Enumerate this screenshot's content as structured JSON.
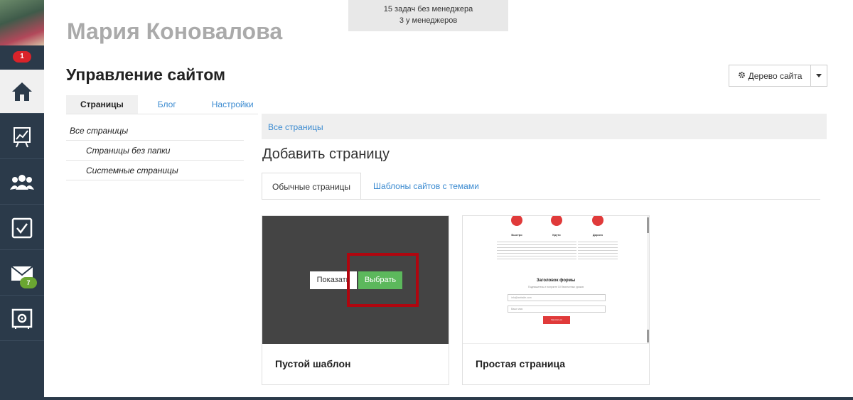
{
  "notice": {
    "line1": "15 задач без менеджера",
    "line2": "3 у менеджеров"
  },
  "user": {
    "name": "Мария Коновалова"
  },
  "page": {
    "title": "Управление сайтом"
  },
  "site_tree": {
    "label": "Дерево сайта"
  },
  "sidebar": {
    "avatar_badge": "1",
    "items": [
      {
        "name": "home-icon",
        "active": true
      },
      {
        "name": "chart-board-icon",
        "active": false
      },
      {
        "name": "users-group-icon",
        "active": false
      },
      {
        "name": "checkbox-icon",
        "active": false
      },
      {
        "name": "mail-icon",
        "active": false,
        "badge": "7"
      },
      {
        "name": "safe-icon",
        "active": false
      }
    ]
  },
  "tabs": [
    {
      "label": "Страницы",
      "active": true
    },
    {
      "label": "Блог",
      "active": false
    },
    {
      "label": "Настройки",
      "active": false
    }
  ],
  "folders": [
    {
      "label": "Все страницы",
      "level": 1
    },
    {
      "label": "Страницы без папки",
      "level": 2
    },
    {
      "label": "Системные страницы",
      "level": 2
    }
  ],
  "breadcrumb": {
    "label": "Все страницы"
  },
  "section": {
    "title": "Добавить страницу"
  },
  "sub_tabs": [
    {
      "label": "Обычные страницы",
      "active": true
    },
    {
      "label": "Шаблоны сайтов с темами",
      "active": false
    }
  ],
  "cards": [
    {
      "caption": "Пустой шаблон",
      "show_label": "Показать",
      "select_label": "Выбрать"
    },
    {
      "caption": "Простая страница",
      "mini": {
        "col_titles": [
          "Быстро",
          "Круто",
          "Дорого"
        ],
        "form_title": "Заголовок формы",
        "form_subtitle": "Подпишитесь и получите 10 бесплатных уроков",
        "email_placeholder": "info@website.com",
        "name_placeholder": "Ваше имя",
        "submit_label": "Записаться"
      }
    }
  ],
  "colors": {
    "sidebar": "#2b3a4a",
    "accent_link": "#3a8ad0",
    "select_button": "#5cb85c",
    "highlight_frame": "#b0060f",
    "badge_red": "#d9232a",
    "badge_green": "#6aa632"
  }
}
